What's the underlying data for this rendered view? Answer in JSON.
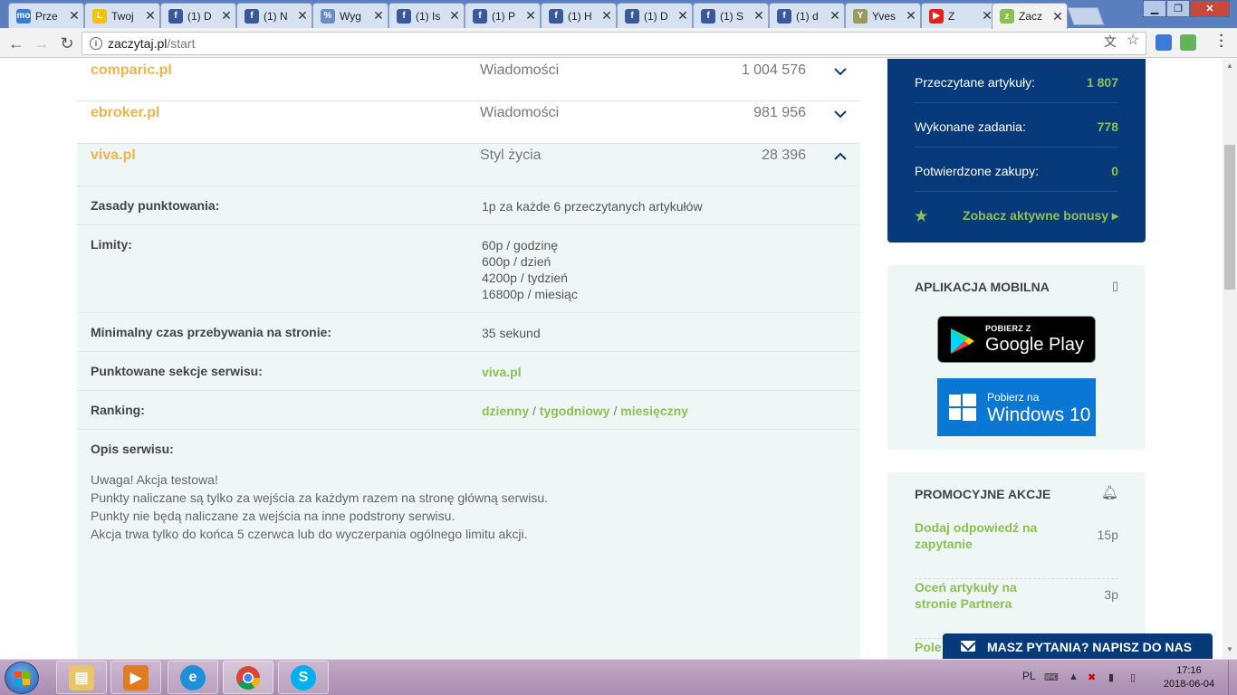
{
  "browser": {
    "tabs": [
      {
        "title": "Prze",
        "fav_bg": "#3c7bd8",
        "fav_txt": "mo"
      },
      {
        "title": "Twoj",
        "fav_bg": "#f4c20d",
        "fav_txt": "L"
      },
      {
        "title": "(1) D",
        "fav_bg": "#3b5998",
        "fav_txt": "f"
      },
      {
        "title": "(1) N",
        "fav_bg": "#3b5998",
        "fav_txt": "f"
      },
      {
        "title": "Wyg",
        "fav_bg": "#6b8cc4",
        "fav_txt": "%"
      },
      {
        "title": "(1) Is",
        "fav_bg": "#3b5998",
        "fav_txt": "f"
      },
      {
        "title": "(1) P",
        "fav_bg": "#3b5998",
        "fav_txt": "f"
      },
      {
        "title": "(1) H",
        "fav_bg": "#3b5998",
        "fav_txt": "f"
      },
      {
        "title": "(1) D",
        "fav_bg": "#3b5998",
        "fav_txt": "f"
      },
      {
        "title": "(1) S",
        "fav_bg": "#3b5998",
        "fav_txt": "f"
      },
      {
        "title": "(1) d",
        "fav_bg": "#3b5998",
        "fav_txt": "f"
      },
      {
        "title": "Yves",
        "fav_bg": "#9a9a5a",
        "fav_txt": "Y"
      },
      {
        "title": "Z",
        "fav_bg": "#e62117",
        "fav_txt": "▶"
      },
      {
        "title": "Zacz",
        "fav_bg": "#8cc152",
        "fav_txt": "z"
      }
    ],
    "tab_close": "✕",
    "url_host": "zaczytaj.pl",
    "url_path": "/start"
  },
  "services": [
    {
      "name": "comparic.pl",
      "category": "Wiadomości",
      "count": "1 004 576",
      "open": false
    },
    {
      "name": "ebroker.pl",
      "category": "Wiadomości",
      "count": "981 956",
      "open": false
    },
    {
      "name": "viva.pl",
      "category": "Styl życia",
      "count": "28 396",
      "open": true
    }
  ],
  "details": {
    "scoring_label": "Zasady punktowania:",
    "scoring_value": "1p za każde 6 przeczytanych artykułów",
    "limits_label": "Limity:",
    "limits": [
      "60p / godzinę",
      "600p / dzień",
      "4200p / tydzień",
      "16800p / miesiąc"
    ],
    "min_time_label": "Minimalny czas przebywania na stronie:",
    "min_time_value": "35 sekund",
    "sections_label": "Punktowane sekcje serwisu:",
    "sections_value": "viva.pl",
    "ranking_label": "Ranking:",
    "ranking_daily": "dzienny",
    "ranking_weekly": "tygodniowy",
    "ranking_monthly": "miesięczny",
    "ranking_sep": "/",
    "desc_label": "Opis serwisu:",
    "desc_lines": [
      "Uwaga! Akcja testowa!",
      "Punkty naliczane są tylko za wejścia za każdym razem na stronę główną serwisu.",
      "Punkty nie będą naliczane za wejścia na inne podstrony serwisu.",
      "Akcja trwa tylko do końca 5 czerwca lub do wyczerpania ogólnego limitu akcji."
    ]
  },
  "stats": {
    "read_label": "Przeczytane artykuły:",
    "read_value": "1 807",
    "tasks_label": "Wykonane zadania:",
    "tasks_value": "778",
    "purchases_label": "Potwierdzone zakupy:",
    "purchases_value": "0",
    "bonus_link": "Zobacz aktywne bonusy ▸"
  },
  "mobile": {
    "title": "APLIKACJA MOBILNA",
    "gp_small": "POBIERZ Z",
    "gp_big": "Google Play",
    "win_small": "Pobierz na",
    "win_big": "Windows 10"
  },
  "promo": {
    "title": "PROMOCYJNE AKCJE",
    "items": [
      {
        "label": "Dodaj odpowiedź na zapytanie",
        "points": "15p"
      },
      {
        "label": "Oceń artykuły na stronie Partnera",
        "points": "3p"
      },
      {
        "label": "Pole",
        "points": ""
      }
    ]
  },
  "ask_button": "MASZ PYTANIA? NAPISZ DO NAS",
  "taskbar": {
    "lang": "PL",
    "time": "17:16",
    "date": "2018-06-04"
  },
  "colors": {
    "accent_green": "#8cc152",
    "brand_navy": "#073a7a",
    "service_orange": "#f0b44c"
  }
}
